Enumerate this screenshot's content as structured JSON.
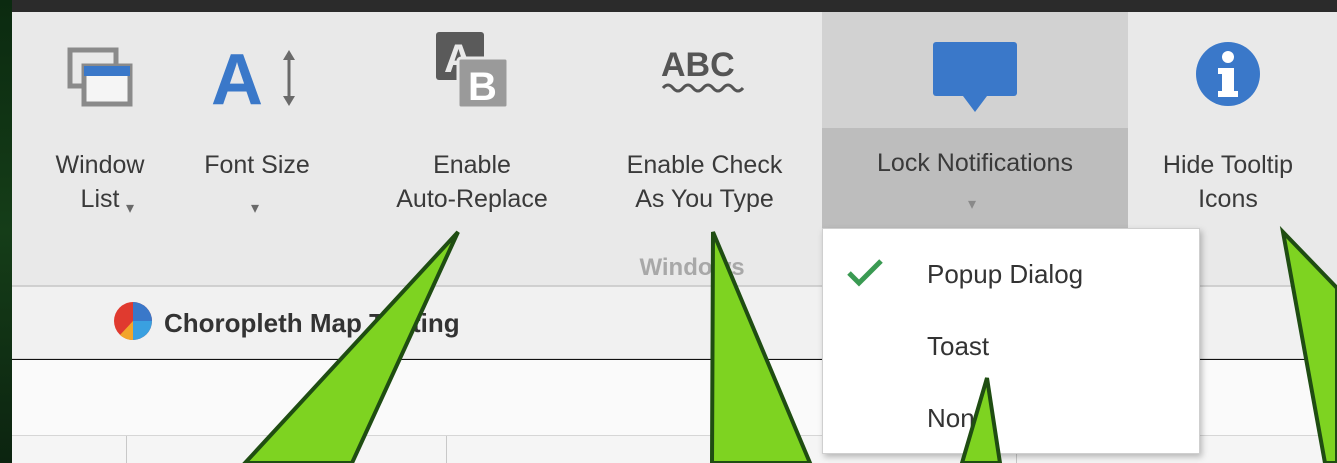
{
  "ribbon": {
    "buttons": [
      {
        "id": "window-list",
        "label": "Window\nList",
        "caret": "▾",
        "icon": "window-list-icon"
      },
      {
        "id": "font-size",
        "label": "Font Size",
        "caret": "▾",
        "icon": "font-size-icon"
      },
      {
        "id": "auto-replace",
        "label": "Enable\nAuto-Replace",
        "icon": "auto-replace-icon"
      },
      {
        "id": "check-as-you-type",
        "label": "Enable Check\nAs You Type",
        "icon": "spellcheck-icon"
      },
      {
        "id": "lock-notifications",
        "label": "Lock Notifications",
        "caret": "▾",
        "icon": "notification-icon"
      },
      {
        "id": "hide-tooltip-icons",
        "label": "Hide Tooltip\nIcons",
        "icon": "info-icon"
      }
    ],
    "group_label": "Windows"
  },
  "notifications_menu": {
    "items": [
      {
        "label": "Popup Dialog",
        "checked": true
      },
      {
        "label": "Toast",
        "checked": false
      },
      {
        "label": "None",
        "checked": false
      }
    ]
  },
  "document_tab": {
    "title": "Choropleth Map Testing"
  },
  "colors": {
    "accent_blue": "#3a78c9",
    "check_green": "#3a9a52",
    "callout_green": "#7ed321",
    "callout_border": "#1f4d12"
  }
}
